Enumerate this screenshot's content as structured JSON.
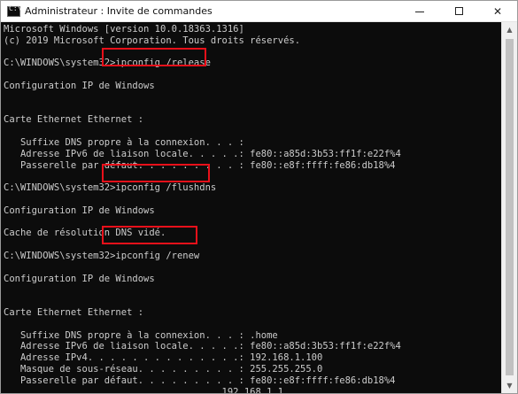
{
  "window": {
    "title": "Administrateur : Invite de commandes",
    "minimize_icon": "minimize-icon",
    "maximize_icon": "maximize-icon",
    "close_glyph": "✕"
  },
  "console": {
    "lines": [
      "Microsoft Windows [version 10.0.18363.1316]",
      "(c) 2019 Microsoft Corporation. Tous droits réservés.",
      "",
      "C:\\WINDOWS\\system32>ipconfig /release",
      "",
      "Configuration IP de Windows",
      "",
      "",
      "Carte Ethernet Ethernet :",
      "",
      "   Suffixe DNS propre à la connexion. . . :",
      "   Adresse IPv6 de liaison locale. . . . .: fe80::a85d:3b53:ff1f:e22f%4",
      "   Passerelle par défaut. . . . . . . . . : fe80::e8f:ffff:fe86:db18%4",
      "",
      "C:\\WINDOWS\\system32>ipconfig /flushdns",
      "",
      "Configuration IP de Windows",
      "",
      "Cache de résolution DNS vidé.",
      "",
      "C:\\WINDOWS\\system32>ipconfig /renew",
      "",
      "Configuration IP de Windows",
      "",
      "",
      "Carte Ethernet Ethernet :",
      "",
      "   Suffixe DNS propre à la connexion. . . : .home",
      "   Adresse IPv6 de liaison locale. . . . .: fe80::a85d:3b53:ff1f:e22f%4",
      "   Adresse IPv4. . . . . . . . . . . . . .: 192.168.1.100",
      "   Masque de sous-réseau. . . . . . . . . : 255.255.255.0",
      "   Passerelle par défaut. . . . . . . . . : fe80::e8f:ffff:fe86:db18%4",
      "                                       192.168.1.1"
    ],
    "highlighted_commands": [
      "ipconfig /release",
      "ipconfig /flushdns",
      "ipconfig /renew"
    ],
    "highlight_color": "#e8101a",
    "text_color": "#cccccc",
    "background": "#0c0c0c"
  }
}
